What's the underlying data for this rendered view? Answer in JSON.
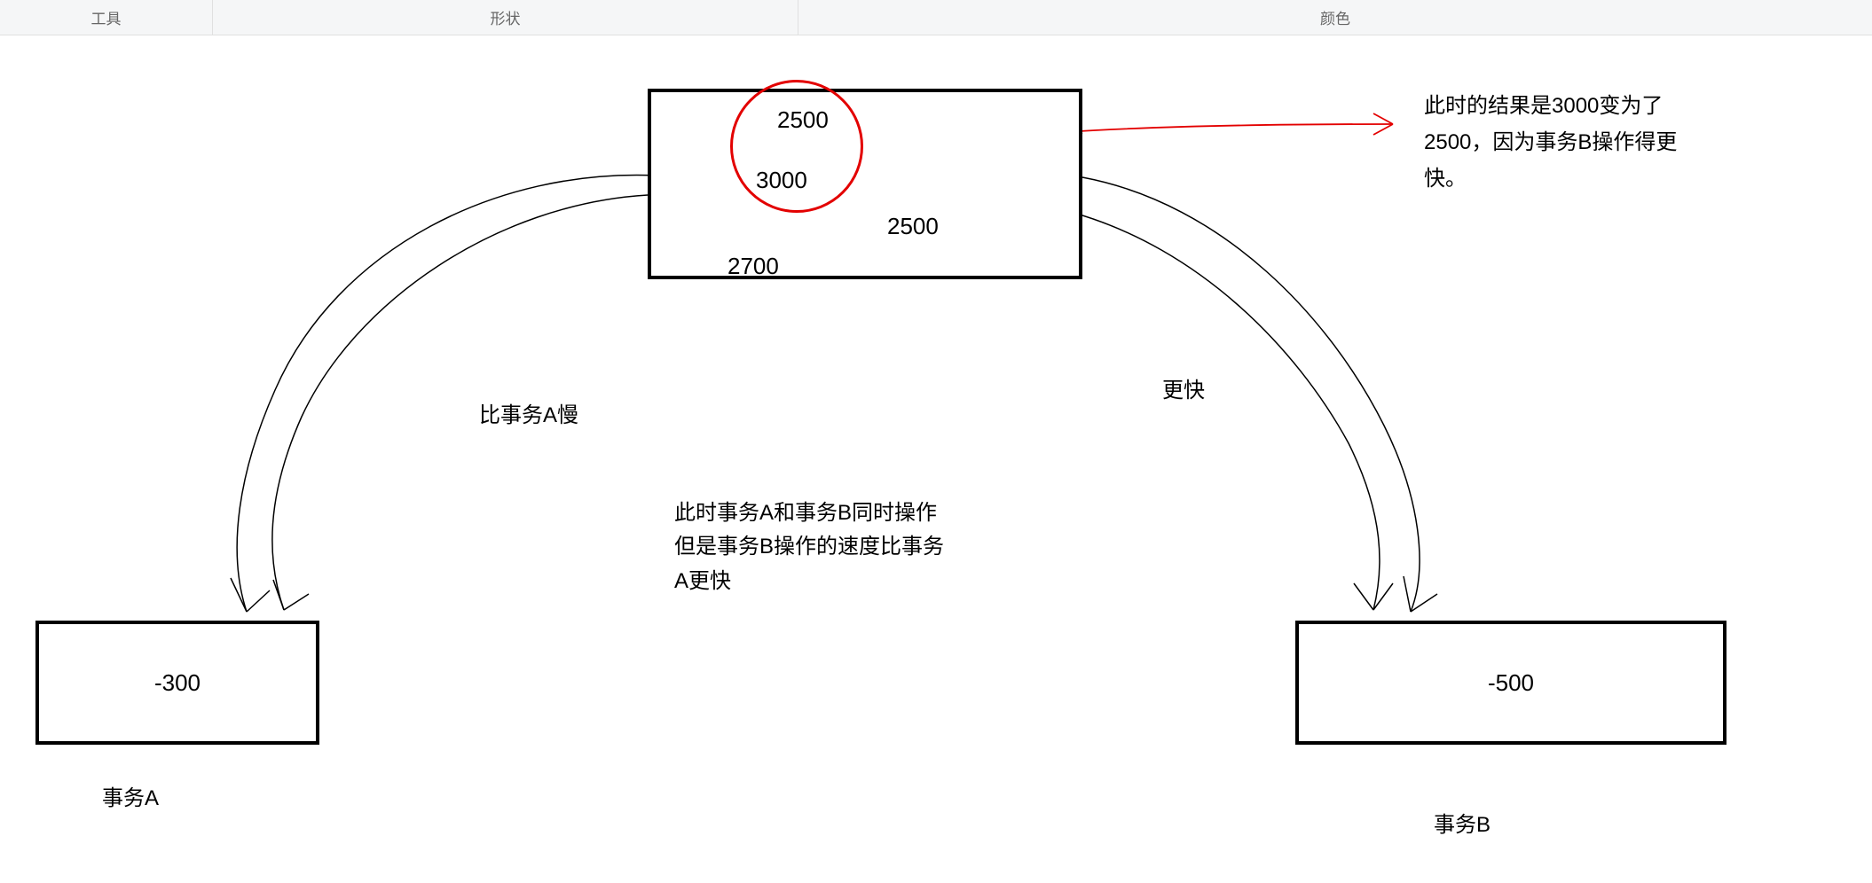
{
  "ribbon": {
    "tools": "工具",
    "shapes": "形状",
    "colors": "颜色"
  },
  "diagram": {
    "topbox": {
      "v1": "2500",
      "v2": "3000",
      "v3": "2500",
      "v4": "2700"
    },
    "leftbox": {
      "value": "-300",
      "label": "事务A"
    },
    "rightbox": {
      "value": "-500",
      "label": "事务B"
    },
    "labelSlow": "比事务A慢",
    "labelFast": "更快",
    "midText1": "此时事务A和事务B同时操作",
    "midText2": "但是事务B操作的速度比事务",
    "midText3": "A更快",
    "rightNote1": "此时的结果是3000变为了",
    "rightNote2": "2500，因为事务B操作得更",
    "rightNote3": "快。"
  }
}
